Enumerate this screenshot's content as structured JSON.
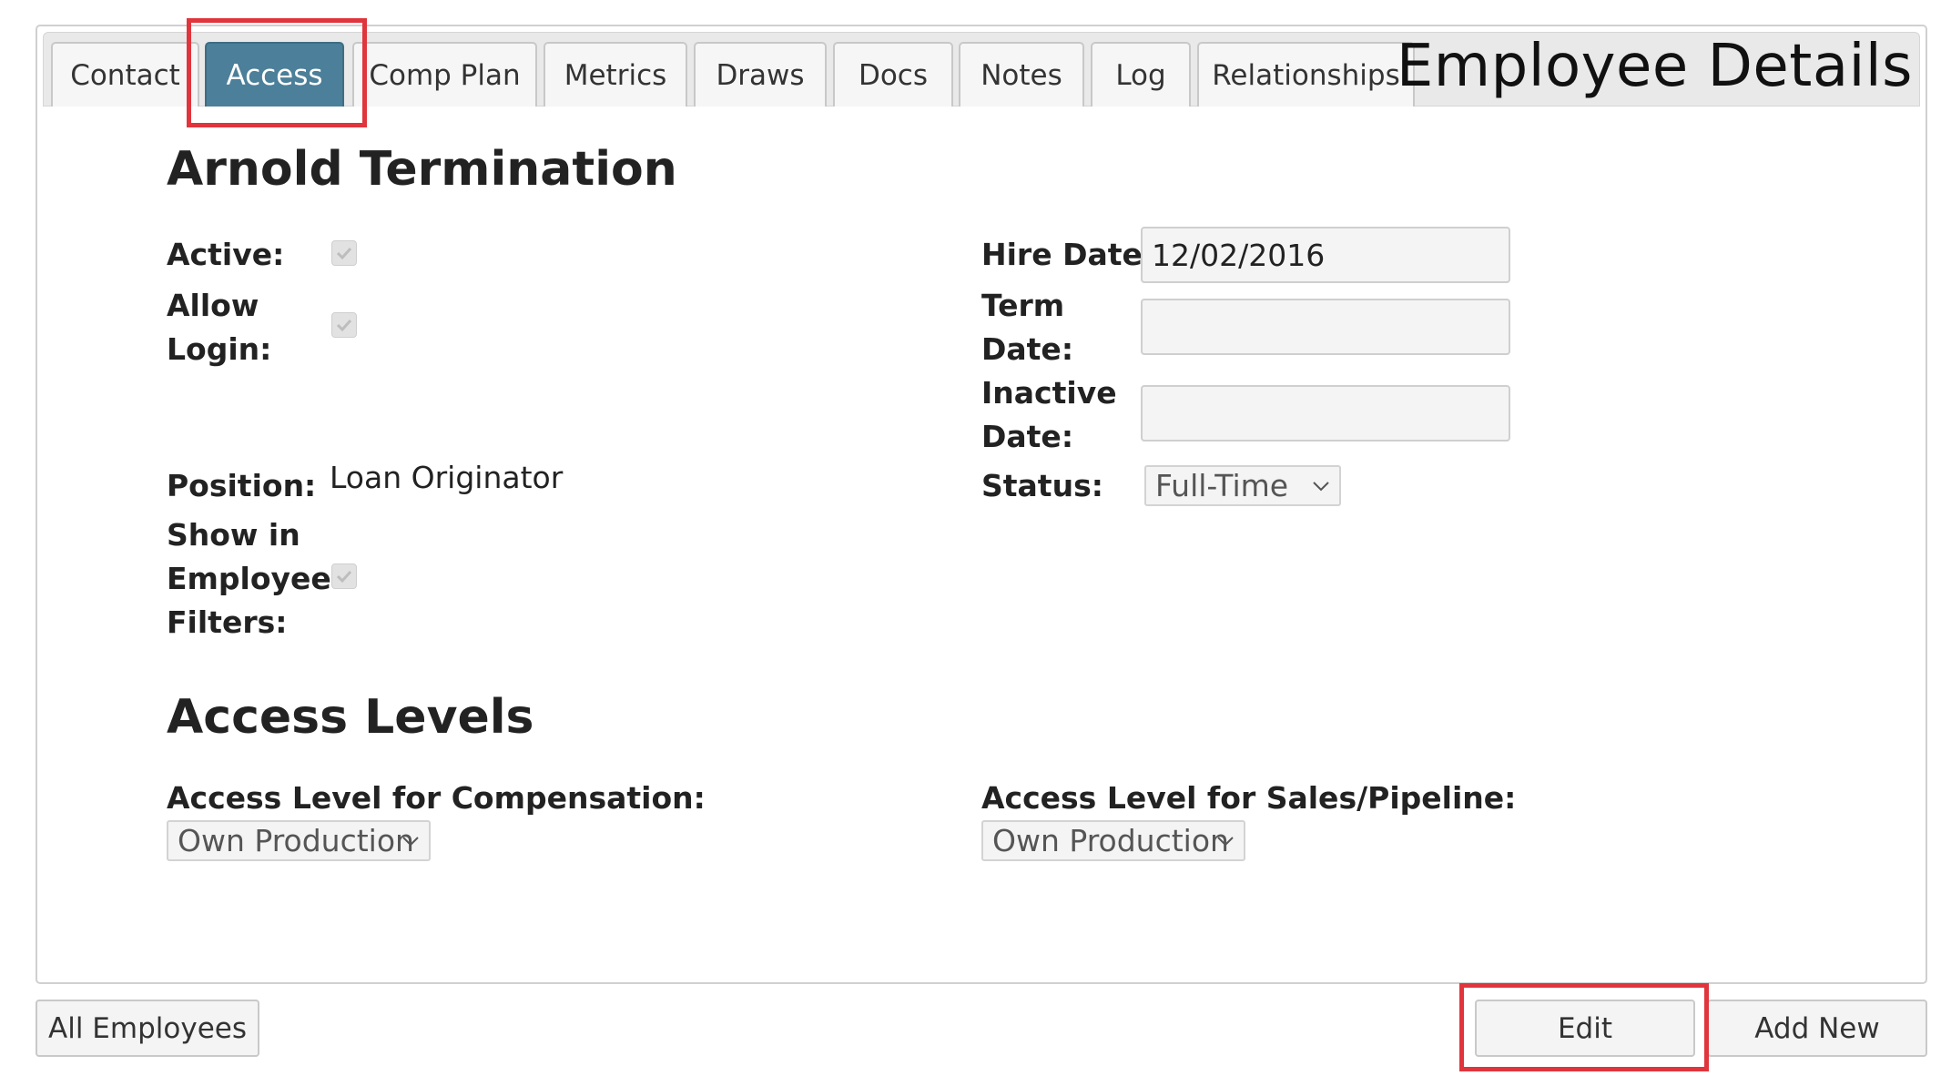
{
  "header": {
    "title": "Employee Details",
    "tabs": [
      {
        "label": "Contact"
      },
      {
        "label": "Access"
      },
      {
        "label": "Comp Plan"
      },
      {
        "label": "Metrics"
      },
      {
        "label": "Draws"
      },
      {
        "label": "Docs"
      },
      {
        "label": "Notes"
      },
      {
        "label": "Log"
      },
      {
        "label": "Relationships"
      }
    ],
    "active_tab": "Access"
  },
  "employee": {
    "name": "Arnold Termination",
    "active_label": "Active:",
    "active": true,
    "allow_login_label": "Allow Login:",
    "allow_login": true,
    "position_label": "Position:",
    "position": "Loan Originator",
    "show_in_filters_label": "Show in Employee Filters:",
    "show_in_filters": true,
    "hire_date_label": "Hire Date:",
    "hire_date": "12/02/2016",
    "term_date_label": "Term Date:",
    "term_date": "",
    "inactive_date_label": "Inactive Date:",
    "inactive_date": "",
    "status_label": "Status:",
    "status": "Full-Time"
  },
  "access_levels": {
    "heading": "Access Levels",
    "compensation_label": "Access Level for Compensation:",
    "compensation_value": "Own Production",
    "sales_label": "Access Level for Sales/Pipeline:",
    "sales_value": "Own Production"
  },
  "footer": {
    "all_employees": "All Employees",
    "edit": "Edit",
    "add_new": "Add New"
  },
  "colors": {
    "active_tab": "#4c7f99",
    "highlight": "#e0353d"
  }
}
